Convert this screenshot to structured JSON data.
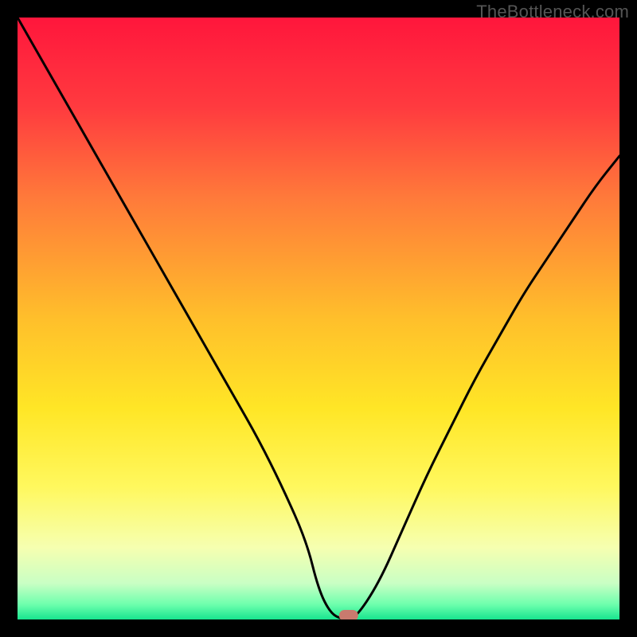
{
  "watermark": "TheBottleneck.com",
  "chart_data": {
    "type": "line",
    "title": "",
    "xlabel": "",
    "ylabel": "",
    "xlim": [
      0,
      100
    ],
    "ylim": [
      0,
      100
    ],
    "background": {
      "type": "vertical-gradient",
      "stops": [
        {
          "offset": 0.0,
          "color": "#ff163c"
        },
        {
          "offset": 0.15,
          "color": "#ff3b3f"
        },
        {
          "offset": 0.3,
          "color": "#ff7a3a"
        },
        {
          "offset": 0.5,
          "color": "#ffbf2b"
        },
        {
          "offset": 0.65,
          "color": "#ffe626"
        },
        {
          "offset": 0.78,
          "color": "#fff85e"
        },
        {
          "offset": 0.88,
          "color": "#f6ffb0"
        },
        {
          "offset": 0.94,
          "color": "#c9ffc4"
        },
        {
          "offset": 0.975,
          "color": "#6effad"
        },
        {
          "offset": 1.0,
          "color": "#18e58f"
        }
      ]
    },
    "series": [
      {
        "name": "bottleneck-curve",
        "color": "#000000",
        "width": 3,
        "x": [
          0,
          4,
          8,
          12,
          16,
          20,
          24,
          28,
          32,
          36,
          40,
          44,
          48,
          50,
          52,
          54,
          56,
          60,
          64,
          68,
          72,
          76,
          80,
          84,
          88,
          92,
          96,
          100
        ],
        "y": [
          100,
          93,
          86,
          79,
          72,
          65,
          58,
          51,
          44,
          37,
          30,
          22,
          13,
          5,
          1,
          0,
          0,
          6,
          15,
          24,
          32,
          40,
          47,
          54,
          60,
          66,
          72,
          77
        ]
      }
    ],
    "marker": {
      "name": "min-marker",
      "shape": "rounded-rect",
      "x": 55,
      "y": 0,
      "color": "#c97a6e"
    }
  }
}
